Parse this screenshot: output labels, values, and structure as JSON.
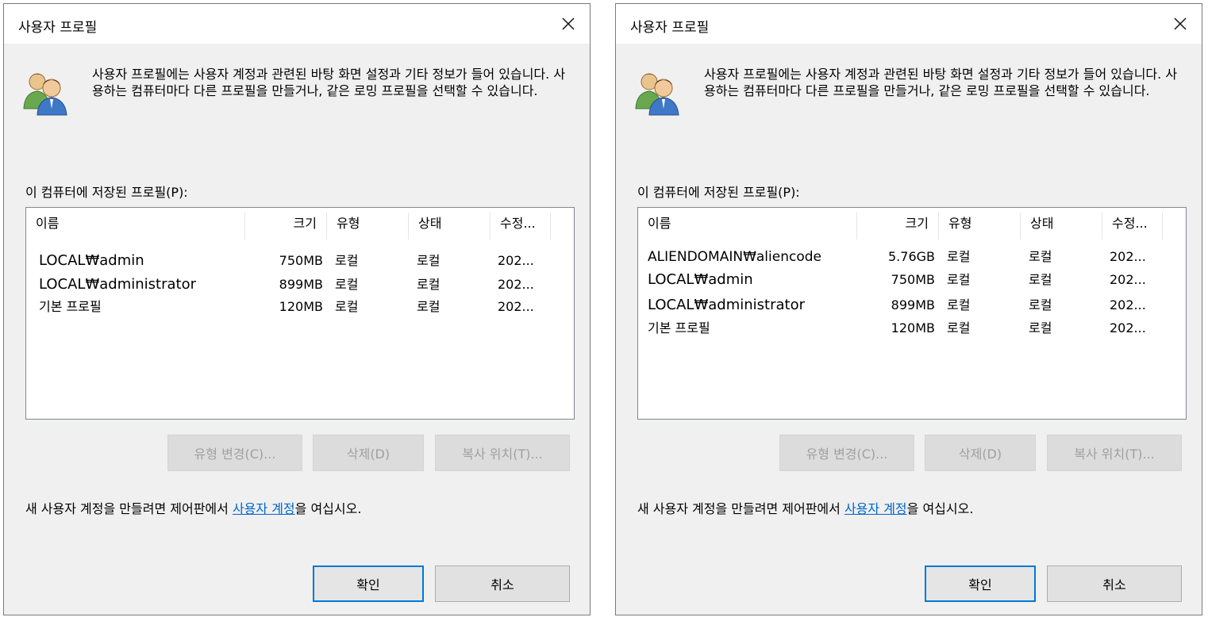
{
  "dialogs": [
    {
      "title": "사용자 프로필",
      "intro": "사용자 프로필에는 사용자 계정과 관련된 바탕 화면 설정과 기타 정보가 들어 있습니다. 사용하는 컴퓨터마다 다른 프로필을 만들거나, 같은 로밍 프로필을 선택할 수 있습니다.",
      "profiles_label": "이 컴퓨터에 저장된 프로필(P):",
      "columns": [
        "이름",
        "크기",
        "유형",
        "상태",
        "수정..."
      ],
      "rows": [
        {
          "name": "LOCAL₩admin",
          "size": "750MB",
          "type": "로컬",
          "status": "로컬",
          "modified": "202..."
        },
        {
          "name": "LOCAL₩administrator",
          "size": "899MB",
          "type": "로컬",
          "status": "로컬",
          "modified": "202..."
        },
        {
          "name": "기본 프로필",
          "size": "120MB",
          "type": "로컬",
          "status": "로컬",
          "modified": "202..."
        }
      ],
      "buttons": {
        "change_type": "유형 변경(C)...",
        "delete": "삭제(D)",
        "copy_to": "복사 위치(T)...",
        "ok": "확인",
        "cancel": "취소"
      },
      "hint": {
        "before": "새 사용자 계정을 만들려면 제어판에서 ",
        "link": "사용자 계정",
        "after": "을 여십시오."
      }
    },
    {
      "title": "사용자 프로필",
      "intro": "사용자 프로필에는 사용자 계정과 관련된 바탕 화면 설정과 기타 정보가 들어 있습니다. 사용하는 컴퓨터마다 다른 프로필을 만들거나, 같은 로밍 프로필을 선택할 수 있습니다.",
      "profiles_label": "이 컴퓨터에 저장된 프로필(P):",
      "columns": [
        "이름",
        "크기",
        "유형",
        "상태",
        "수정..."
      ],
      "rows": [
        {
          "name": "ALIENDOMAIN₩aliencode",
          "size": "5.76GB",
          "type": "로컬",
          "status": "로컬",
          "modified": "202..."
        },
        {
          "name": "LOCAL₩admin",
          "size": "750MB",
          "type": "로컬",
          "status": "로컬",
          "modified": "202..."
        },
        {
          "name": "LOCAL₩administrator",
          "size": "899MB",
          "type": "로컬",
          "status": "로컬",
          "modified": "202..."
        },
        {
          "name": "기본 프로필",
          "size": "120MB",
          "type": "로컬",
          "status": "로컬",
          "modified": "202..."
        }
      ],
      "buttons": {
        "change_type": "유형 변경(C)...",
        "delete": "삭제(D)",
        "copy_to": "복사 위치(T)...",
        "ok": "확인",
        "cancel": "취소"
      },
      "hint": {
        "before": "새 사용자 계정을 만들려면 제어판에서 ",
        "link": "사용자 계정",
        "after": "을 여십시오."
      }
    }
  ],
  "icons": {
    "window_close": "close-icon",
    "users": "users-icon"
  },
  "colors": {
    "link": "#0066cc",
    "focus_border": "#0078d7",
    "dialog_bg": "#f0f0f0"
  }
}
